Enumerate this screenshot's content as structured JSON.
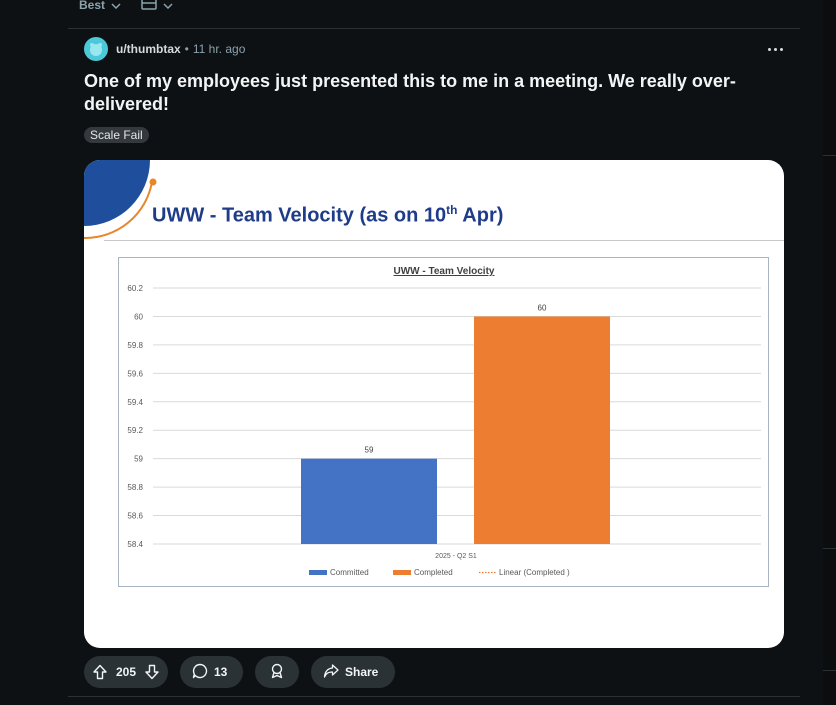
{
  "sort": {
    "label": "Best",
    "chevron_icon": "chevron-down-icon",
    "view_icon": "card-view-icon"
  },
  "post": {
    "author": "u/thumbtax",
    "separator": "•",
    "time": "11 hr. ago",
    "title": "One of my employees just presented this to me in a meeting. We really over-delivered!",
    "flair": "Scale Fail",
    "avatar_color": "#4cc9d8"
  },
  "slide": {
    "title_prefix": "UWW - Team Velocity (as on 10",
    "title_sup": "th",
    "title_suffix": " Apr)",
    "title_color": "#1f3c88"
  },
  "chart_data": {
    "type": "bar",
    "title": "UWW - Team Velocity",
    "categories": [
      "2025 - Q2 S1"
    ],
    "series": [
      {
        "name": "Committed",
        "values": [
          59
        ],
        "color": "#4472c4"
      },
      {
        "name": "Completed",
        "values": [
          60
        ],
        "color": "#ed7d31"
      }
    ],
    "trendline": {
      "name": "Linear (Completed )",
      "style": "dotted",
      "color": "#ed7d31"
    },
    "ylim": [
      58.4,
      60.2
    ],
    "yticks": [
      "58.4",
      "58.6",
      "58.8",
      "59",
      "59.2",
      "59.4",
      "59.6",
      "59.8",
      "60",
      "60.2"
    ],
    "data_labels": [
      "59",
      "60"
    ],
    "grid": true,
    "legend_position": "bottom"
  },
  "actions": {
    "upvotes": "205",
    "comments": "13",
    "share_label": "Share",
    "icons": [
      "upvote-icon",
      "downvote-icon",
      "comment-icon",
      "award-icon",
      "share-icon"
    ]
  }
}
